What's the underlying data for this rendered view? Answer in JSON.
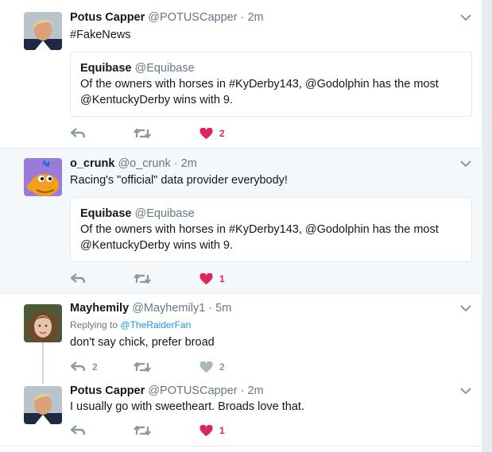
{
  "tweets": [
    {
      "name": "Potus Capper",
      "handle": "@POTUSCapper",
      "dot": "·",
      "time": "2m",
      "text": "#FakeNews",
      "quote": {
        "name": "Equibase",
        "handle": "@Equibase",
        "line1": "Of the owners with horses in #KyDerby143, @Godolphin has the most",
        "line2": "@KentuckyDerby wins with 9."
      },
      "replies": "",
      "likes": "2",
      "liked": true
    },
    {
      "name": "o_crunk",
      "handle": "@o_crunk",
      "dot": "·",
      "time": "2m",
      "text": "Racing's \"official\" data provider everybody!",
      "quote": {
        "name": "Equibase",
        "handle": "@Equibase",
        "line1": "Of the owners with horses in #KyDerby143, @Godolphin has the most",
        "line2": "@KentuckyDerby wins with 9."
      },
      "replies": "",
      "likes": "1",
      "liked": true
    },
    {
      "name": "Mayhemily",
      "handle": "@Mayhemily1",
      "dot": "·",
      "time": "5m",
      "reply_prefix": "Replying to",
      "reply_to": "@TheRaiderFan",
      "text": "don't say chick, prefer broad",
      "replies": "2",
      "likes": "2",
      "liked": false
    },
    {
      "name": "Potus Capper",
      "handle": "@POTUSCapper",
      "dot": "·",
      "time": "2m",
      "text": "I usually go with sweetheart. Broads love that.",
      "replies": "",
      "likes": "1",
      "liked": true
    }
  ],
  "colors": {
    "like_active": "#e0245e",
    "icon_grey": "#8899a6",
    "link": "#1b95e0"
  },
  "icons": [
    "reply-icon",
    "retweet-icon",
    "heart-icon",
    "chevron-down-icon"
  ]
}
